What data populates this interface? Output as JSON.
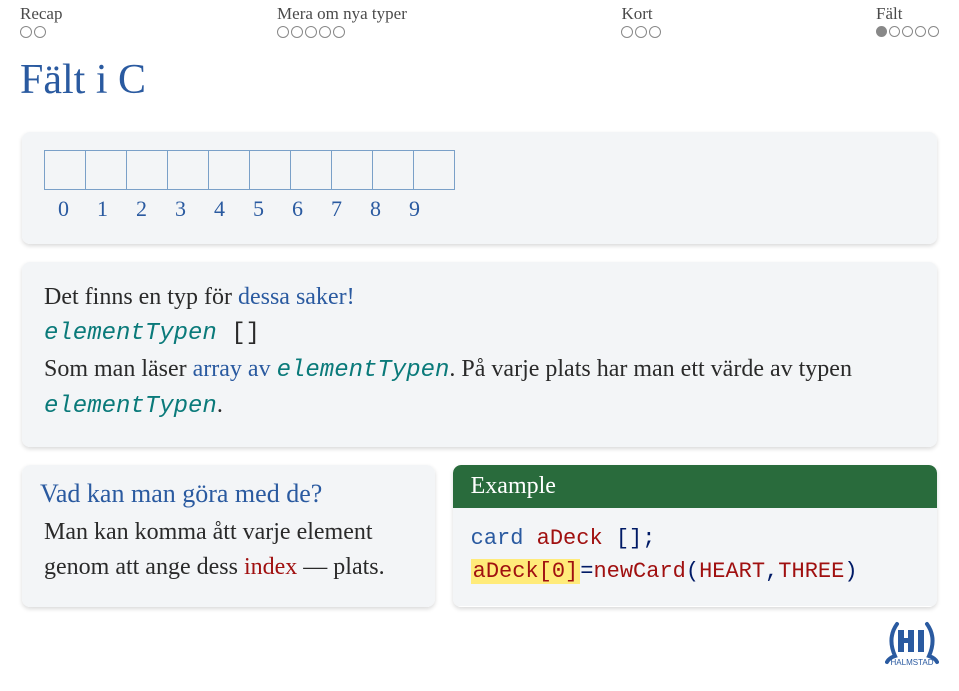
{
  "nav": {
    "items": [
      {
        "label": "Recap",
        "dots": 2,
        "filled": -1
      },
      {
        "label": "Mera om nya typer",
        "dots": 5,
        "filled": -1
      },
      {
        "label": "Kort",
        "dots": 3,
        "filled": -1
      },
      {
        "label": "Fält",
        "dots": 5,
        "filled": 0
      }
    ]
  },
  "title": "Fält i C",
  "array": {
    "indices": [
      "0",
      "1",
      "2",
      "3",
      "4",
      "5",
      "6",
      "7",
      "8",
      "9"
    ]
  },
  "box1": {
    "line1_a": "Det finns en typ för ",
    "line1_b": "dessa saker!",
    "line2_a": "elementTypen",
    "line2_b": " []",
    "line3_a": "Som man läser ",
    "line3_b": "array av ",
    "line3_c": "elementTypen",
    "line3_d": ". På varje plats har man ett värde av typen ",
    "line3_e": "elementTypen",
    "line3_f": "."
  },
  "vad": {
    "header": "Vad kan man göra med de?",
    "body_a": "Man kan komma ått varje element genom att ange dess ",
    "body_b": "index",
    "body_c": " — plats."
  },
  "example": {
    "header": "Example",
    "l1_a": "card",
    "l1_b": " aDeck ",
    "l1_c": "[];",
    "l2_a": "aDeck[0]",
    "l2_b": "=",
    "l2_c": "newCard",
    "l2_d": "(",
    "l2_e": "HEART",
    "l2_f": ",",
    "l2_g": "THREE",
    "l2_h": ")"
  }
}
